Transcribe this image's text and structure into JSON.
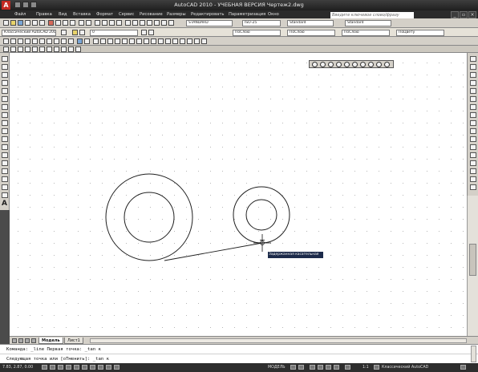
{
  "app": {
    "title": "AutoCAD 2010 - УЧЕБНАЯ ВЕРСИЯ   Чертеж2.dwg",
    "logo": "A"
  },
  "menu": {
    "items": [
      "Файл",
      "Правка",
      "Вид",
      "Вставка",
      "Формат",
      "Сервис",
      "Рисование",
      "Размеры",
      "Редактировать",
      "Параметризация",
      "Окно"
    ],
    "search_placeholder": "Введите ключевое слово/фразу"
  },
  "toolbars": {
    "layer_value": "0",
    "textstyle": "STANDARD",
    "dimstyle": "ISO-25",
    "tablestyle": "Standard",
    "mleaderstyle": "Standard",
    "workspace_value": "Классический AutoCAD 2009",
    "bylayer_color": "ПоСлою",
    "bylayer_linetype": "ПоСлою",
    "bylayer_lineweight": "ПоСлою",
    "plotstyle": "ПоЦвету"
  },
  "drawing": {
    "tooltip": "Задержанная касательная",
    "colors": {
      "stroke": "#1f1f1f",
      "tooltip_bg": "#1c2a4a"
    }
  },
  "tabs": {
    "items": [
      {
        "label": "Модель",
        "active": true
      },
      {
        "label": "Лист1",
        "active": false
      }
    ]
  },
  "command_line": {
    "line1": "Команда:  _line Первая точка: _tan к",
    "line2": "Следующая точка или [оТменить]: _tan к"
  },
  "status": {
    "coords": "7.83, 2.87, 0.00",
    "model_label": "МОДЕЛЬ",
    "scale": "1:1",
    "workspace": "Классический AutoCAD"
  }
}
